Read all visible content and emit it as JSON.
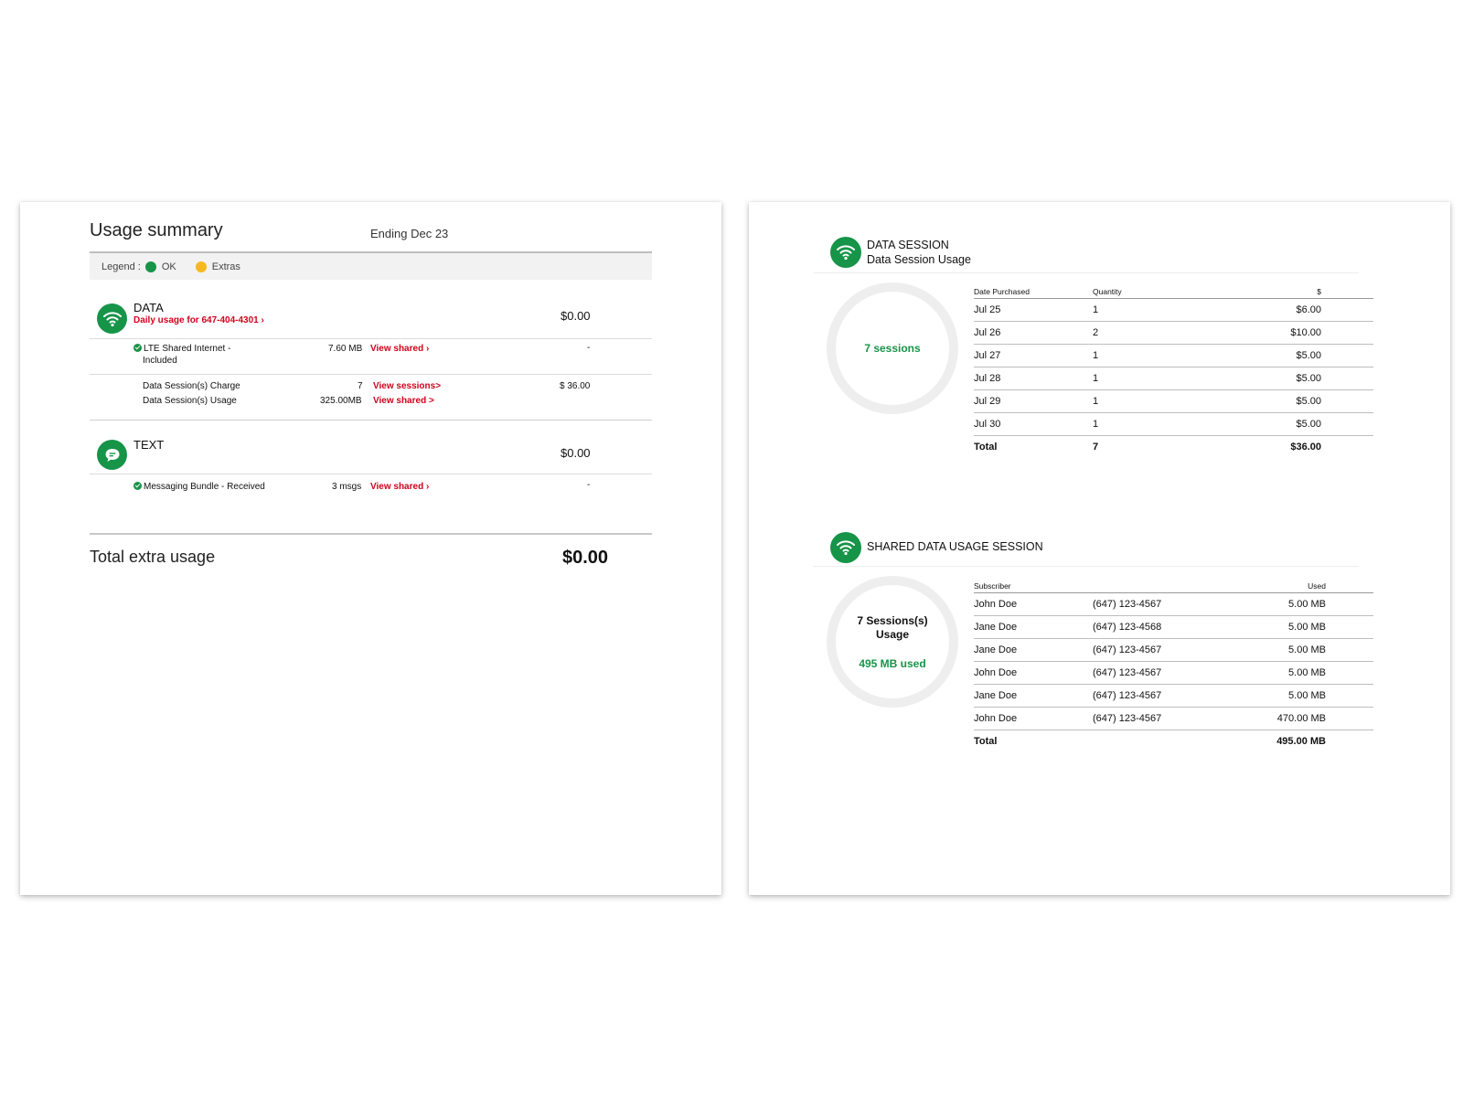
{
  "colors": {
    "brand_green": "#169448",
    "extras_yellow": "#f6b81e",
    "link_red": "#d0021b"
  },
  "summary": {
    "title": "Usage summary",
    "ending": "Ending Dec 23",
    "legend": {
      "label": "Legend :",
      "ok": "OK",
      "extras": "Extras"
    },
    "data": {
      "icon": "wifi-icon",
      "title": "DATA",
      "daily_link": "Daily usage for 647-404-4301 ›",
      "amount": "$0.00",
      "lte": {
        "name_line1": "LTE Shared Internet -",
        "name_line2": "Included",
        "value": "7.60 MB",
        "link": "View shared ›",
        "amount": "-"
      },
      "sessions": {
        "charge_label": "Data Session(s) Charge",
        "charge_value": "7",
        "charge_link": "View sessions>",
        "charge_amount": "$ 36.00",
        "usage_label": "Data Session(s) Usage",
        "usage_value": "325.00MB",
        "usage_link": "View shared >"
      }
    },
    "text": {
      "icon": "chat-bubble-icon",
      "title": "TEXT",
      "amount": "$0.00",
      "messaging": {
        "name": "Messaging Bundle - Received",
        "value": "3 msgs",
        "link": "View shared ›",
        "amount": "-"
      }
    },
    "total": {
      "label": "Total extra usage",
      "value": "$0.00"
    }
  },
  "data_session": {
    "icon": "wifi-icon",
    "title": "DATA SESSION",
    "subtitle": "Data Session Usage",
    "ring_text": "7 sessions",
    "headers": [
      "Date Purchased",
      "Quantity",
      "$"
    ],
    "rows": [
      [
        "Jul 25",
        "1",
        "$6.00"
      ],
      [
        "Jul 26",
        "2",
        "$10.00"
      ],
      [
        "Jul 27",
        "1",
        "$5.00"
      ],
      [
        "Jul 28",
        "1",
        "$5.00"
      ],
      [
        "Jul 29",
        "1",
        "$5.00"
      ],
      [
        "Jul 30",
        "1",
        "$5.00"
      ]
    ],
    "total": [
      "Total",
      "7",
      "$36.00"
    ]
  },
  "shared_session": {
    "icon": "wifi-icon",
    "title": "SHARED DATA USAGE SESSION",
    "ring_line1": "7 Sessions(s)",
    "ring_line2": "Usage",
    "ring_used": "495 MB used",
    "headers": [
      "Subscriber",
      "",
      "Used"
    ],
    "rows": [
      [
        "John Doe",
        "(647) 123-4567",
        "5.00 MB"
      ],
      [
        "Jane Doe",
        "(647) 123-4568",
        "5.00 MB"
      ],
      [
        "Jane Doe",
        "(647) 123-4567",
        "5.00 MB"
      ],
      [
        "John Doe",
        "(647) 123-4567",
        "5.00 MB"
      ],
      [
        "Jane Doe",
        "(647) 123-4567",
        "5.00 MB"
      ],
      [
        "John Doe",
        "(647) 123-4567",
        "470.00 MB"
      ]
    ],
    "total": [
      "Total",
      "",
      "495.00 MB"
    ]
  }
}
